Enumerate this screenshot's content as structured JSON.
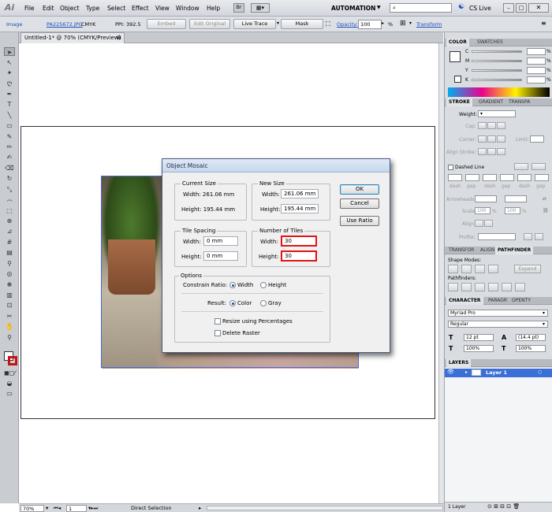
{
  "app": {
    "logo": "Ai"
  },
  "menubar": {
    "items": [
      "File",
      "Edit",
      "Object",
      "Type",
      "Select",
      "Effect",
      "View",
      "Window",
      "Help"
    ],
    "br_badge": "Br",
    "workspace": "AUTOMATION",
    "cslive": "CS Live"
  },
  "control_bar": {
    "object_type": "Image",
    "filename": "PA225672.JPG",
    "color_mode": "CMYK",
    "ppi": "PPI: 392.5",
    "embed": "Embed",
    "edit_original": "Edit Original",
    "live_trace": "Live Trace",
    "mask": "Mask",
    "opacity_label": "Opacity:",
    "opacity_value": "100",
    "opacity_unit": "%",
    "transform": "Transform"
  },
  "document": {
    "tab_title": "Untitled-1* @ 70% (CMYK/Preview)"
  },
  "status_bar": {
    "zoom": "70%",
    "page": "1",
    "tool": "Direct Selection"
  },
  "dialog": {
    "title": "Object Mosaic",
    "current_size": {
      "label": "Current Size",
      "width": "Width: 261.06 mm",
      "height": "Height: 195.44 mm"
    },
    "new_size": {
      "label": "New Size",
      "width_label": "Width:",
      "width_value": "261.06 mm",
      "height_label": "Height:",
      "height_value": "195.44 mm"
    },
    "tile_spacing": {
      "label": "Tile Spacing",
      "width_label": "Width:",
      "width_value": "0 mm",
      "height_label": "Height:",
      "height_value": "0 mm"
    },
    "num_tiles": {
      "label": "Number of Tiles",
      "width_label": "Width:",
      "width_value": "30",
      "height_label": "Height:",
      "height_value": "30"
    },
    "buttons": {
      "ok": "OK",
      "cancel": "Cancel",
      "use_ratio": "Use Ratio"
    },
    "options": {
      "label": "Options",
      "constrain_label": "Constrain Ratio:",
      "constrain_width": "Width",
      "constrain_height": "Height",
      "result_label": "Result:",
      "result_color": "Color",
      "result_gray": "Gray",
      "resize_pct": "Resize using Percentages",
      "delete_raster": "Delete Raster"
    }
  },
  "panels": {
    "color": {
      "tabs": [
        "COLOR",
        "SWATCHES"
      ],
      "channels": [
        "C",
        "M",
        "Y",
        "K"
      ],
      "unit": "%"
    },
    "stroke": {
      "tabs": [
        "STROKE",
        "GRADIENT",
        "TRANSPA"
      ],
      "weight_label": "Weight:",
      "cap_label": "Cap:",
      "corner_label": "Corner:",
      "limit_label": "Limit:",
      "align_label": "Align Stroke:",
      "dashed_label": "Dashed Line",
      "dash_labels": [
        "dash",
        "gap",
        "dash",
        "gap",
        "dash",
        "gap"
      ],
      "arrowheads_label": "Arrowheads:",
      "scale_label": "Scale:",
      "scale_a": "100",
      "scale_b": "100",
      "scale_unit": "%",
      "align_label2": "Align:",
      "profile_label": "Profile:"
    },
    "pathfinder": {
      "tabs": [
        "TRANSFOR",
        "ALIGN",
        "PATHFINDER"
      ],
      "shape_modes": "Shape Modes:",
      "expand": "Expand",
      "pathfinders": "Pathfinders:"
    },
    "character": {
      "tabs": [
        "CHARACTER",
        "PARAGR",
        "OPENTY"
      ],
      "font": "Myriad Pro",
      "style": "Regular",
      "size": "12 pt",
      "leading": "(14.4 pt)",
      "h_scale": "100%",
      "v_scale": "100%"
    },
    "layers": {
      "tab": "LAYERS",
      "layer_name": "Layer 1",
      "count": "1 Layer"
    }
  },
  "colors": {
    "accent": "#1a4fb8",
    "highlight": "#e01515",
    "layer_sel": "#3b6fd6"
  }
}
